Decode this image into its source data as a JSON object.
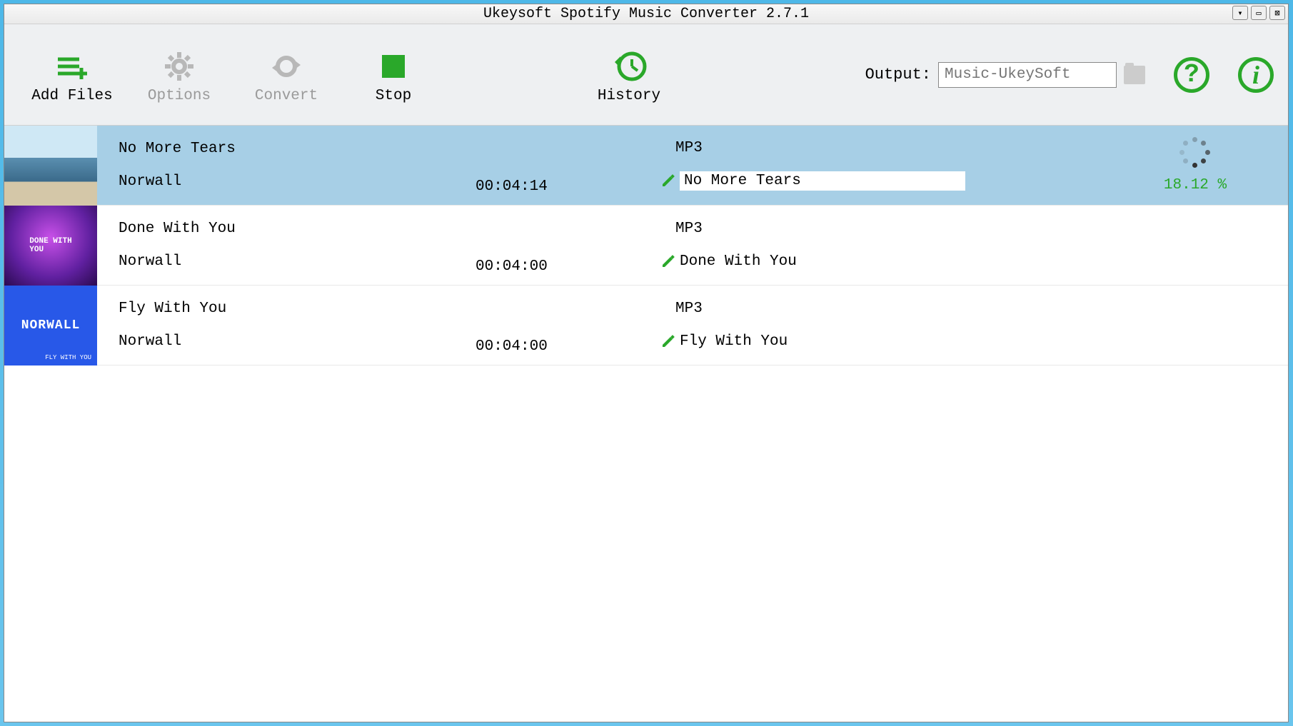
{
  "window": {
    "title": "Ukeysoft Spotify Music Converter 2.7.1"
  },
  "toolbar": {
    "add_files": "Add Files",
    "options": "Options",
    "convert": "Convert",
    "stop": "Stop",
    "history": "History",
    "output_label": "Output:",
    "output_placeholder": "Music-UkeySoft"
  },
  "colors": {
    "accent_green": "#2aa82a"
  },
  "tracks": [
    {
      "title": "No More Tears",
      "artist": "Norwall",
      "duration": "00:04:14",
      "format": "MP3",
      "filename": "No More Tears",
      "progress": "18.12 %",
      "active": true
    },
    {
      "title": "Done With You",
      "artist": "Norwall",
      "duration": "00:04:00",
      "format": "MP3",
      "filename": "Done With You",
      "progress": "",
      "active": false
    },
    {
      "title": "Fly With You",
      "artist": "Norwall",
      "duration": "00:04:00",
      "format": "MP3",
      "filename": "Fly With You",
      "progress": "",
      "active": false
    }
  ]
}
